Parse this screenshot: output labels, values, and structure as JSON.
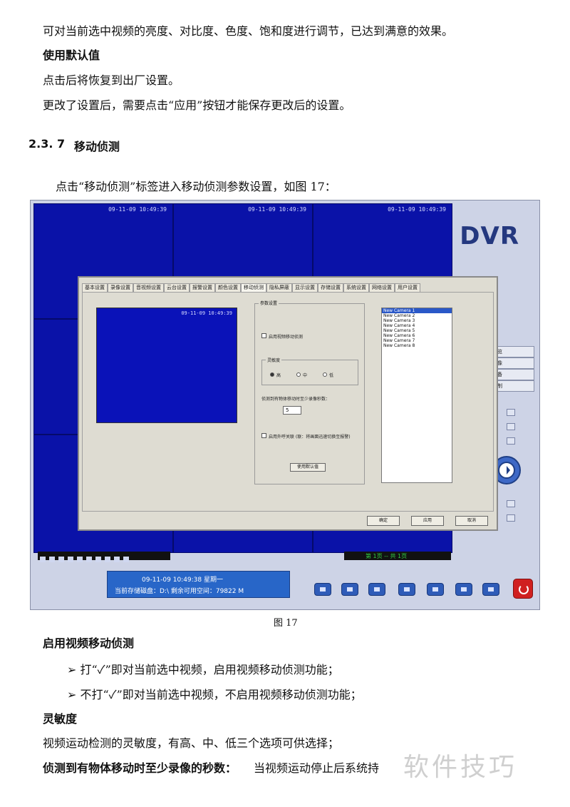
{
  "text": {
    "intro": "可对当前选中视频的亮度、对比度、色度、饱和度进行调节，已达到满意的效果。",
    "defaults_heading": "使用默认值",
    "defaults_desc": "点击后将恢复到出厂设置。",
    "apply_note": "更改了设置后，需要点击“应用”按钮才能保存更改后的设置。",
    "section_num": "2.3. 7",
    "section_title": "移动侦测",
    "enter_desc": "点击“移动侦测”标签进入移动侦测参数设置，如图 17：",
    "caption": "图 17",
    "enable_heading": "启用视频移动侦测",
    "bullet1": "➢ 打“✓”即对当前选中视频，启用视频移动侦测功能；",
    "bullet2": "➢ 不打“✓”即对当前选中视频，不启用视频移动侦测功能；",
    "sens_heading": "灵敏度",
    "sens_desc": "视频运动检测的灵敏度，有高、中、低三个选项可供选择；",
    "record_heading": "侦测到有物体移动时至少录像的秒数：",
    "record_desc": "当视频运动停止后系统持",
    "watermark": "软件技巧"
  },
  "screenshot": {
    "logo": "DVR",
    "timestamp": "09-11-09 10:49:39",
    "tabs": [
      "基本设置",
      "录像设置",
      "音视频设置",
      "云台设置",
      "报警设置",
      "颜色设置",
      "移动侦测",
      "隐私屏蔽",
      "显示设置",
      "存储设置",
      "系统设置",
      "网络设置",
      "用户设置"
    ],
    "param_title": "参数设置",
    "enable_label": "启用视频移动侦测",
    "sensitivity_label": "灵敏度",
    "sens_high": "高",
    "sens_mid": "中",
    "sens_low": "低",
    "seconds_label": "侦测到有物体移动时至少录像秒数：",
    "seconds_value": "5",
    "alarm_label": "启用外呼关联 (联：将画面迅速切换至报警)",
    "defaults_button": "使用默认值",
    "cameras": [
      "New Camera 1",
      "New Camera 2",
      "New Camera 3",
      "New Camera 4",
      "New Camera 5",
      "New Camera 6",
      "New Camera 7",
      "New Camera 8"
    ],
    "ok_button": "确定",
    "apply_button": "应用",
    "cancel_button": "取消",
    "side_buttons": [
      "预览",
      "录像",
      "设备",
      "控制"
    ],
    "page_indicator": "第 1页 -- 共 1页",
    "status_line1": "09-11-09    10:49:38    星期一",
    "status_line2": "当前存储磁盘：D:\\   剩余可用空间：79822 M"
  }
}
